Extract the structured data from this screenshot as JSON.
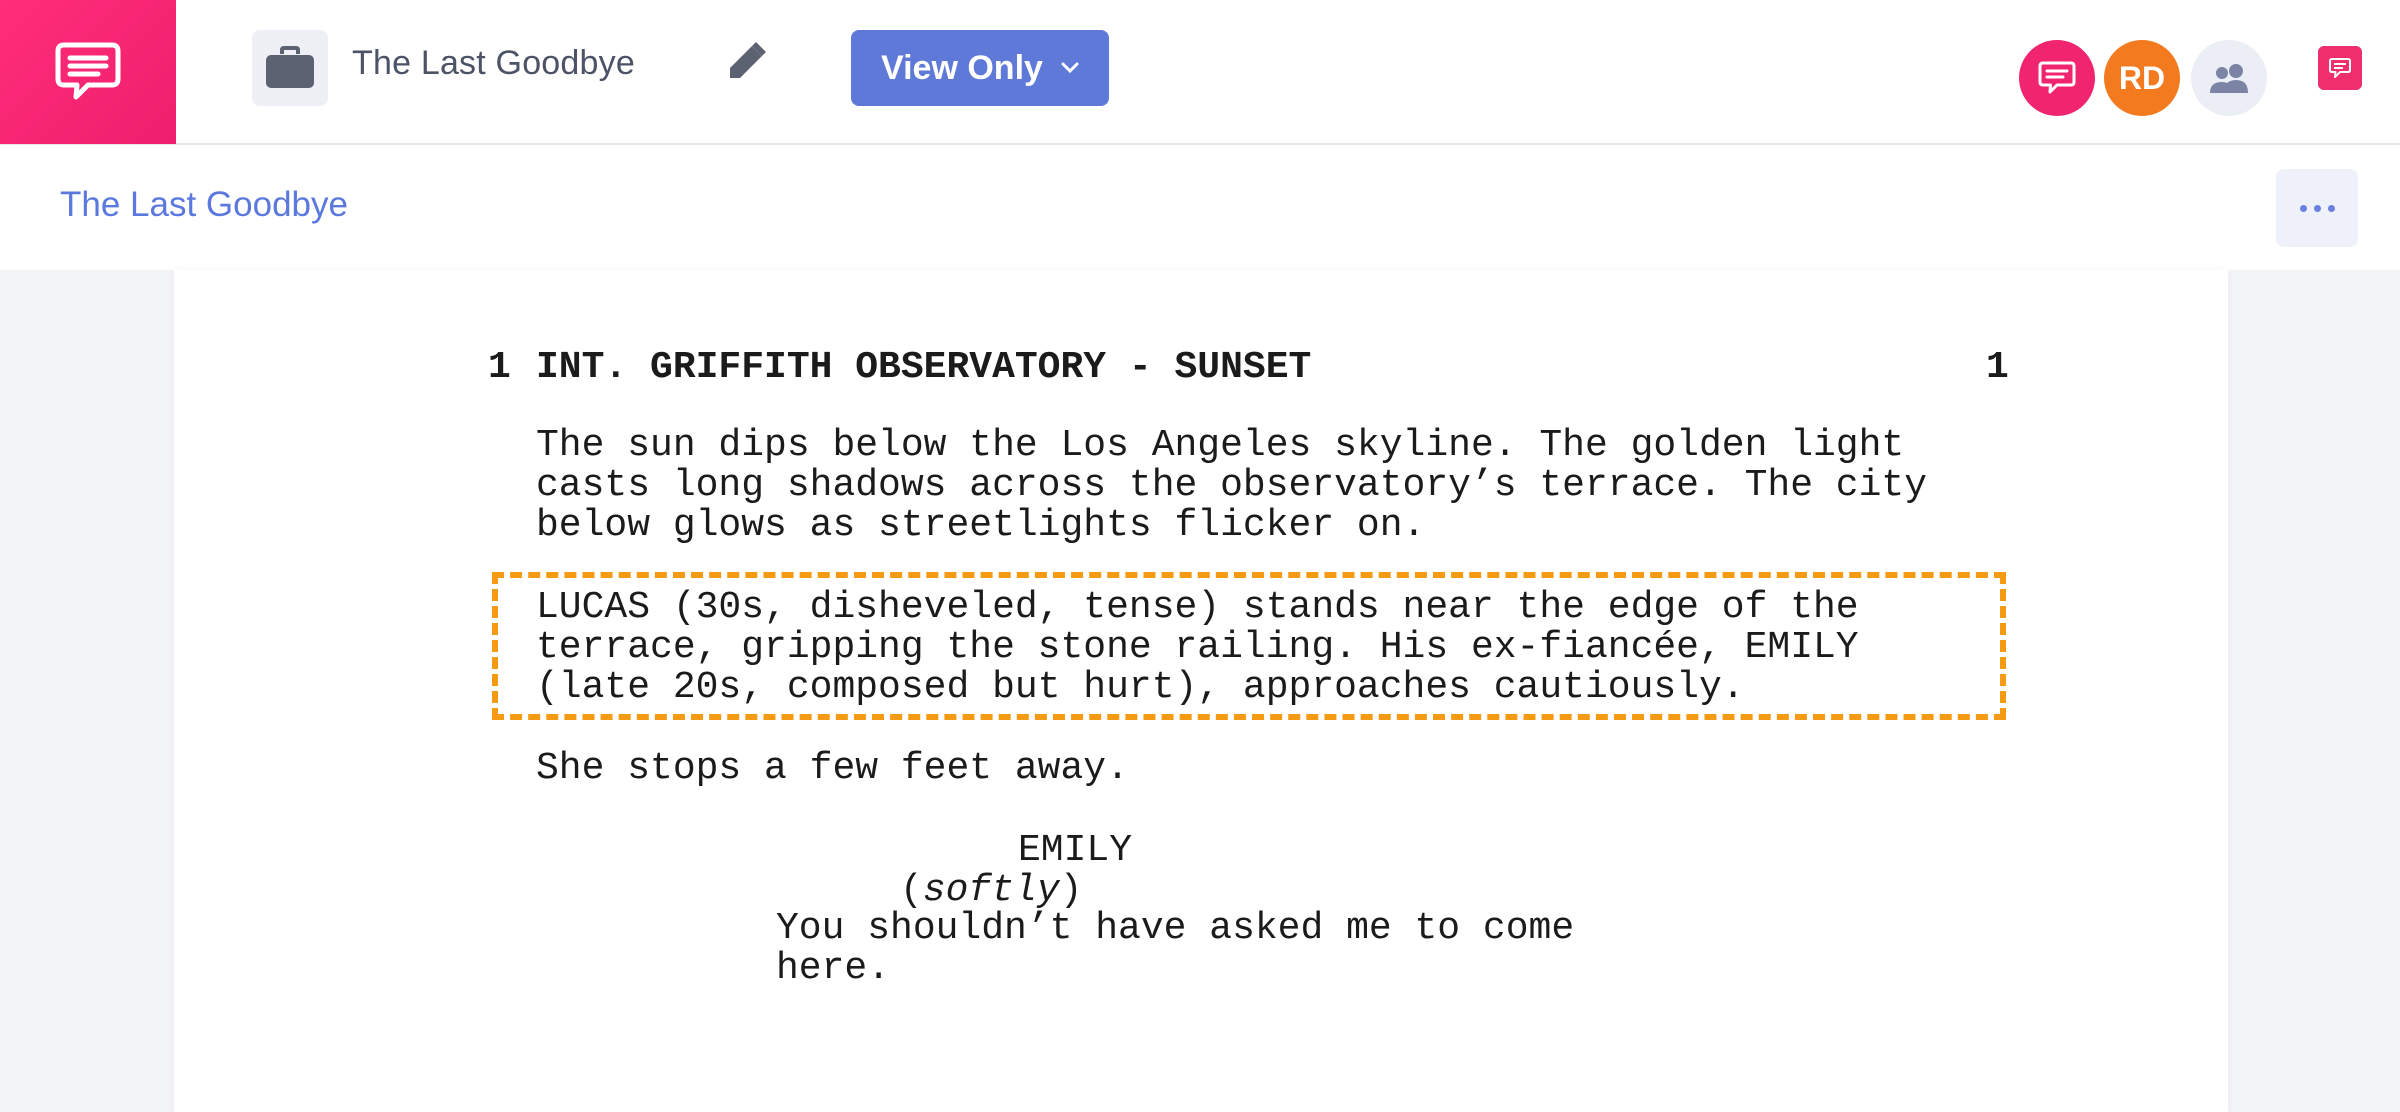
{
  "topbar": {
    "brand_icon": "chat-bubble-logo-icon",
    "project_icon": "briefcase-icon",
    "project_title": "The Last Goodbye",
    "edit_icon": "pencil-icon",
    "view_mode_label": "View Only",
    "view_mode_icon": "chevron-down-icon",
    "avatars": [
      {
        "type": "icon",
        "icon": "chat-icon",
        "color": "#f0246f"
      },
      {
        "type": "initials",
        "label": "RD",
        "color": "#f37a1f"
      },
      {
        "type": "icon",
        "icon": "team-icon",
        "color": "#eceef6"
      }
    ],
    "comments_icon": "comment-icon"
  },
  "subheader": {
    "breadcrumb": "The Last Goodbye",
    "more_icon": "more-horizontal-icon"
  },
  "script": {
    "scene_number": "1",
    "scene_heading": "INT. GRIFFITH OBSERVATORY - SUNSET",
    "action_1": "The sun dips below the Los Angeles skyline. The golden light\ncasts long shadows across the observatory’s terrace. The city\nbelow glows as streetlights flicker on.",
    "action_2": "LUCAS (30s, disheveled, tense) stands near the edge of the\nterrace, gripping the stone railing. His ex-fiancée, EMILY\n(late 20s, composed but hurt), approaches cautiously.",
    "action_3": "She stops a few feet away.",
    "character": "EMILY",
    "parenthetical": "softly",
    "dialogue": "You shouldn’t have asked me to come\nhere."
  },
  "colors": {
    "brand": "#ef1f6d",
    "accent": "#5f79d8",
    "highlight_border": "#f49b13"
  }
}
